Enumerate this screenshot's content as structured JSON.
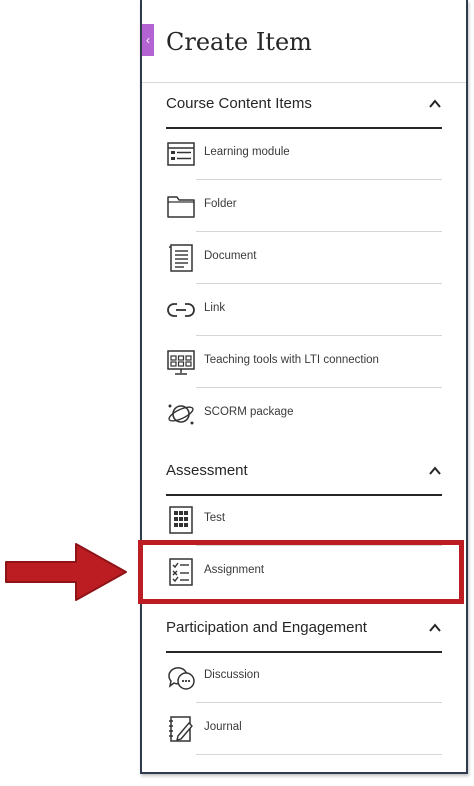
{
  "panel": {
    "title": "Create Item",
    "collapse_glyph": "‹"
  },
  "sections": [
    {
      "title": "Course Content Items",
      "expanded": true,
      "items": [
        {
          "label": "Learning module",
          "icon": "learning-module-icon"
        },
        {
          "label": "Folder",
          "icon": "folder-icon"
        },
        {
          "label": "Document",
          "icon": "document-icon"
        },
        {
          "label": "Link",
          "icon": "link-icon"
        },
        {
          "label": "Teaching tools with LTI connection",
          "icon": "lti-tools-icon"
        },
        {
          "label": "SCORM package",
          "icon": "scorm-package-icon"
        }
      ]
    },
    {
      "title": "Assessment",
      "expanded": true,
      "items": [
        {
          "label": "Test",
          "icon": "test-icon"
        },
        {
          "label": "Assignment",
          "icon": "assignment-icon",
          "highlighted": true
        }
      ]
    },
    {
      "title": "Participation and Engagement",
      "expanded": true,
      "items": [
        {
          "label": "Discussion",
          "icon": "discussion-icon"
        },
        {
          "label": "Journal",
          "icon": "journal-icon"
        }
      ]
    }
  ],
  "colors": {
    "accent_tab": "#b464d2",
    "highlight_red": "#bb1d23",
    "text_dark": "#262626"
  }
}
